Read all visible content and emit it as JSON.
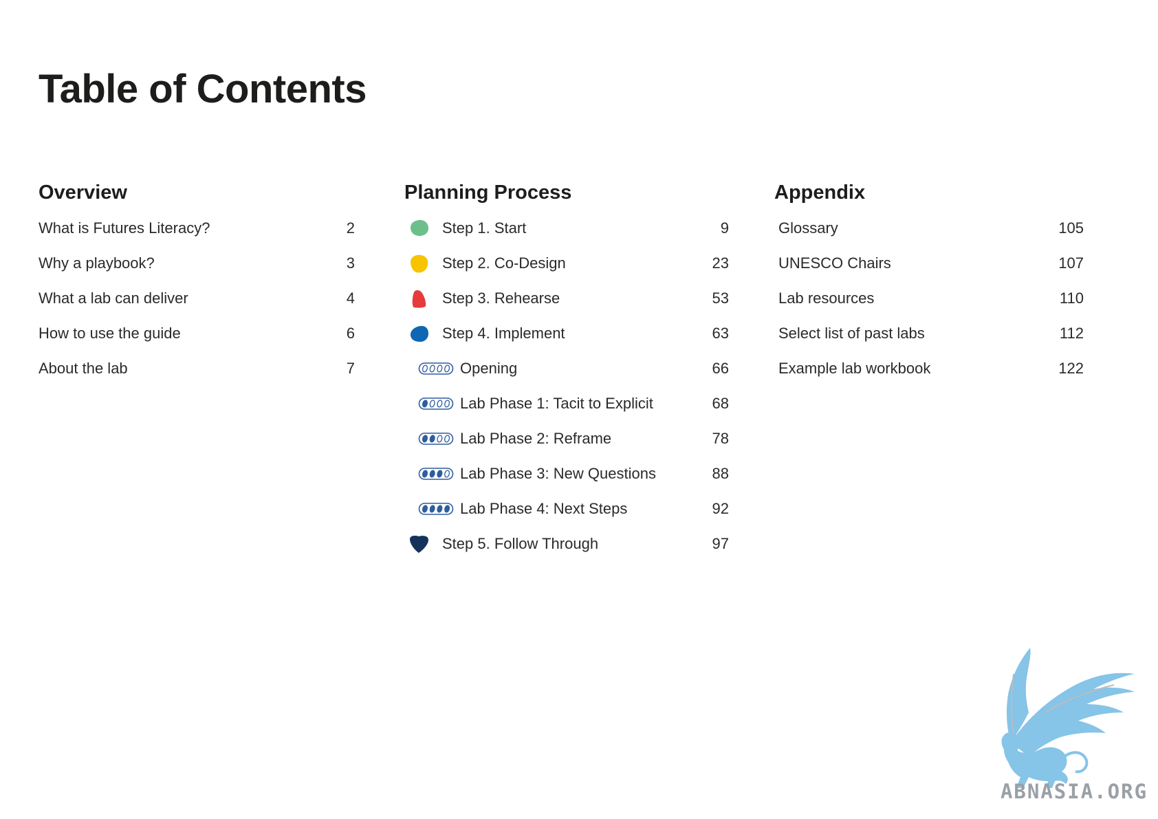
{
  "title": "Table of Contents",
  "overview": {
    "heading": "Overview",
    "entries": [
      {
        "label": "What is Futures Literacy?",
        "page": "2"
      },
      {
        "label": "Why a playbook?",
        "page": "3"
      },
      {
        "label": "What a lab can deliver",
        "page": "4"
      },
      {
        "label": "How to use the guide",
        "page": "6"
      },
      {
        "label": "About the lab",
        "page": "7"
      }
    ]
  },
  "planning": {
    "heading": "Planning Process",
    "entries": [
      {
        "label": "Step 1. Start",
        "page": "9",
        "icon": "green-blob-icon",
        "color": "#6cbf8a"
      },
      {
        "label": "Step 2. Co-Design",
        "page": "23",
        "icon": "yellow-blob-icon",
        "color": "#f7c400"
      },
      {
        "label": "Step 3. Rehearse",
        "page": "53",
        "icon": "red-blob-icon",
        "color": "#e63b3b"
      },
      {
        "label": "Step 4. Implement",
        "page": "63",
        "icon": "blue-blob-icon",
        "color": "#0f66b3"
      },
      {
        "label": "Opening",
        "page": "66",
        "icon": "phase-0-of-4-icon",
        "filled": 0
      },
      {
        "label": "Lab Phase 1: Tacit to Explicit",
        "page": "68",
        "icon": "phase-1-of-4-icon",
        "filled": 1
      },
      {
        "label": "Lab Phase 2: Reframe",
        "page": "78",
        "icon": "phase-2-of-4-icon",
        "filled": 2
      },
      {
        "label": "Lab Phase 3: New Questions",
        "page": "88",
        "icon": "phase-3-of-4-icon",
        "filled": 3
      },
      {
        "label": "Lab Phase 4: Next Steps",
        "page": "92",
        "icon": "phase-4-of-4-icon",
        "filled": 4
      },
      {
        "label": "Step 5. Follow Through",
        "page": "97",
        "icon": "navy-heart-blob-icon",
        "color": "#15335a"
      }
    ]
  },
  "appendix": {
    "heading": "Appendix",
    "entries": [
      {
        "label": "Glossary",
        "page": "105"
      },
      {
        "label": "UNESCO Chairs",
        "page": "107"
      },
      {
        "label": "Lab resources",
        "page": "110"
      },
      {
        "label": "Select list of past labs",
        "page": "112"
      },
      {
        "label": "Example lab workbook",
        "page": "122"
      }
    ]
  },
  "watermark": {
    "text": "ABNASIA.ORG",
    "icon": "griffin-logo-icon",
    "color": "#86c4e8"
  },
  "phase_icon_color": "#2f5d9e"
}
